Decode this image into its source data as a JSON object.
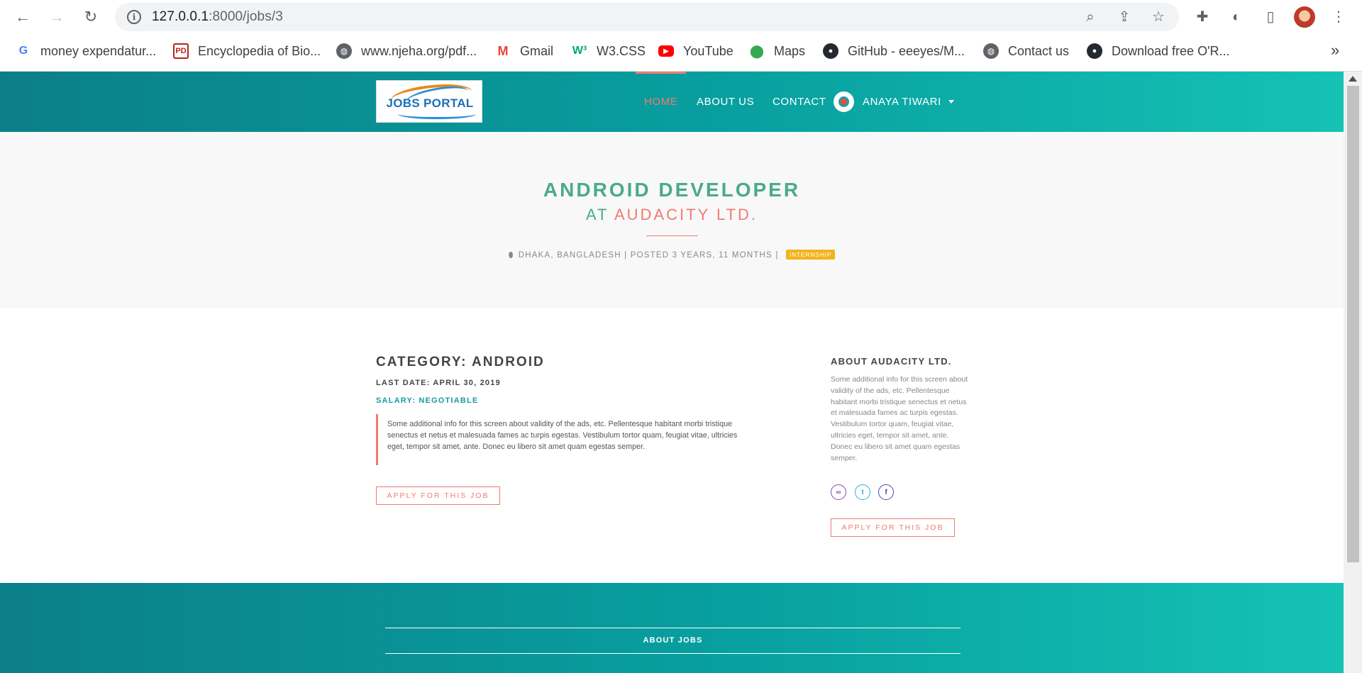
{
  "browser": {
    "url_host": "127.0.0.1",
    "url_path": ":8000/jobs/3",
    "bookmarks": [
      {
        "label": "money expendatur...",
        "icon": "google-icon"
      },
      {
        "label": "Encyclopedia of Bio...",
        "icon": "pd-icon"
      },
      {
        "label": "www.njeha.org/pdf...",
        "icon": "globe-icon"
      },
      {
        "label": "Gmail",
        "icon": "gmail-icon"
      },
      {
        "label": "W3.CSS",
        "icon": "w3-icon"
      },
      {
        "label": "YouTube",
        "icon": "youtube-icon"
      },
      {
        "label": "Maps",
        "icon": "maps-icon"
      },
      {
        "label": "GitHub - eeeyes/M...",
        "icon": "github-icon"
      },
      {
        "label": "Contact us",
        "icon": "globe-icon"
      },
      {
        "label": "Download free O'R...",
        "icon": "github-icon"
      }
    ]
  },
  "nav": {
    "logo_text": "JOBS PORTAL",
    "items": [
      "HOME",
      "ABOUT US",
      "CONTACT"
    ],
    "user_name": "ANAYA TIWARI"
  },
  "job": {
    "title": "ANDROID DEVELOPER",
    "at": "AT",
    "company": "AUDACITY LTD.",
    "location": "DHAKA, BANGLADESH",
    "posted": "| POSTED 3 YEARS, 11 MONTHS |",
    "type_badge": "INTERNSHIP",
    "category": "CATEGORY: ANDROID",
    "last_date": "LAST DATE: APRIL 30, 2019",
    "salary": "SALARY: NEGOTIABLE",
    "description": "Some additional info for this screen about validity of the ads, etc. Pellentesque habitant morbi tristique senectus et netus et malesuada fames ac turpis egestas. Vestibulum tortor quam, feugiat vitae, ultricies eget, tempor sit amet, ante. Donec eu libero sit amet quam egestas semper.",
    "apply_label": "APPLY FOR THIS JOB"
  },
  "sidebar": {
    "title": "ABOUT AUDACITY LTD.",
    "text": "Some additional info for this screen about validity of the ads, etc. Pellentesque habitant morbi tristique senectus et netus et malesuada fames ac turpis egestas. Vestibulum tortor quam, feugiat vitae, ultricies eget, tempor sit amet, ante. Donec eu libero sit amet quam egestas semper.",
    "apply_label": "APPLY FOR THIS JOB",
    "social_icons": [
      "link-icon",
      "twitter-icon",
      "facebook-icon"
    ]
  },
  "footer": {
    "title": "ABOUT JOBS"
  },
  "colors": {
    "accent": "#f07a72",
    "green": "#4aab86",
    "teal": "#08a0a0",
    "badge": "#f3b31c"
  }
}
